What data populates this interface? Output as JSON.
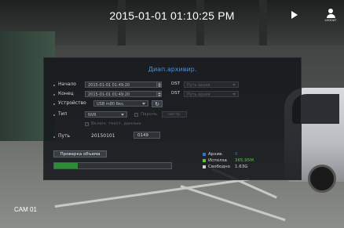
{
  "top_bar": {
    "datetime": "2015-01-01 01:10:25 PM",
    "play_icon": "play-icon",
    "logout_icon": "user-icon",
    "logout_label": "LOGOUT"
  },
  "camera": {
    "label": "CAM 01"
  },
  "dialog": {
    "title": "Диап.архивир.",
    "start": {
      "label": "Начало",
      "value": "2015-01-01 01:49:20",
      "dst_label": "DST",
      "dst_value": "Путь архив"
    },
    "end": {
      "label": "Конец",
      "value": "2015-01-01 01:49:20",
      "dst_label": "DST",
      "dst_value": "Путь архив"
    },
    "device": {
      "label": "Устройство",
      "value": "USB m80 Rev.",
      "refresh_icon": "refresh-icon"
    },
    "type": {
      "label": "Тип",
      "value": "NVR",
      "password_label": "Пароль",
      "settings_button": "настр.",
      "include_text_label": "Включ. текст. данные"
    },
    "path": {
      "label": "Путь",
      "date": "20150101",
      "number": "0149"
    },
    "check_button": "Проверка объема",
    "capacity": {
      "used_fraction": 0.2,
      "colors": {
        "archive": "#3b6fd6",
        "used": "#5cc43a",
        "free": "#9a9a9a"
      },
      "legend": [
        {
          "label": "Архив.",
          "value": "0",
          "color": "#3b6fd6"
        },
        {
          "label": "Исполза",
          "value": "365.95M",
          "color": "#5cc43a"
        },
        {
          "label": "Свободно",
          "value": "1.63G",
          "color": "#cfcfcf"
        }
      ]
    }
  }
}
